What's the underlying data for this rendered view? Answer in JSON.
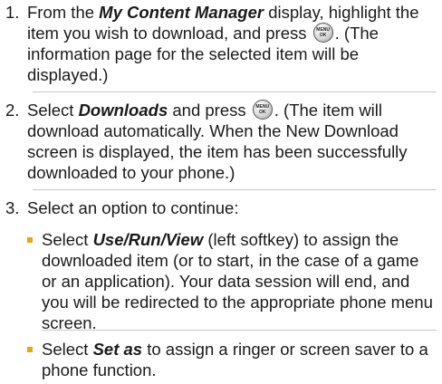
{
  "steps": [
    {
      "number": "1.",
      "pre": "From the ",
      "em": "My Content Manager",
      "mid": " display, highlight the item you wish to download, and press ",
      "post": ". (The information page for the selected item will be displayed.)"
    },
    {
      "number": "2.",
      "pre": "Select ",
      "em": "Downloads",
      "mid": " and press ",
      "post": ". (The item will download automatically. When the New Download screen is displayed, the item has been successfully downloaded to your phone.)"
    },
    {
      "number": "3.",
      "text": "Select an option to continue:"
    }
  ],
  "options": [
    {
      "pre": "Select ",
      "em": "Use/Run/View",
      "post": " (left softkey) to assign the downloaded item (or to start, in the case of a game or an application). Your data session will end, and you will be redirected to the appropriate phone menu screen."
    },
    {
      "pre": "Select ",
      "em": "Set as",
      "post": " to assign a ringer or screen saver to a phone function."
    }
  ],
  "menu_key": {
    "icon": "menu-ok-key-icon",
    "top_label": "MENU",
    "bottom_label": "OK"
  },
  "colors": {
    "bullet": "#e8a317",
    "divider": "#c8c8c8"
  }
}
